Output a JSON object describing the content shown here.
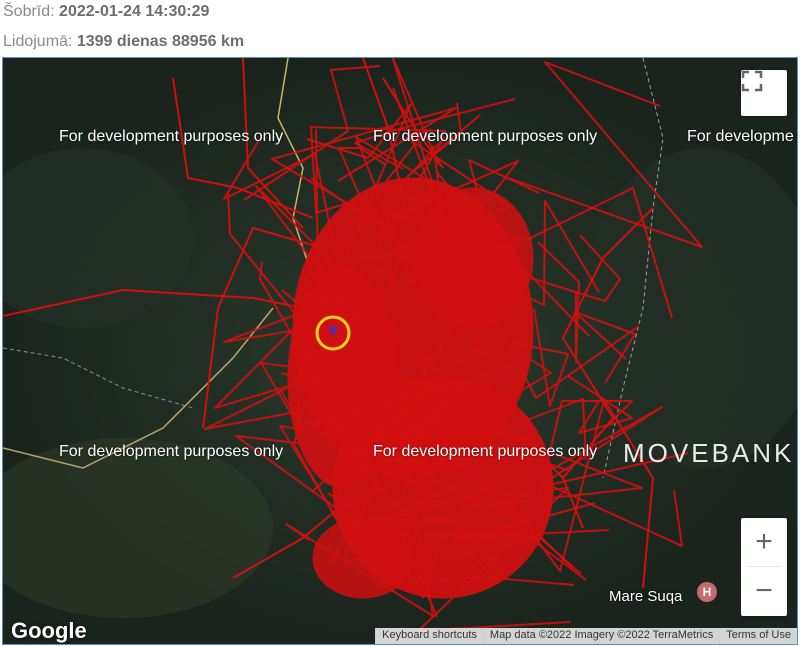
{
  "status": {
    "now_label": "Šobrīd:",
    "now_value": "2022-01-24 14:30:29",
    "flight_label": "Lidojumā:",
    "flight_value": "1399 dienas 88956 km"
  },
  "map": {
    "watermark": "For development purposes only",
    "watermark_partial": "For developme",
    "brand": "MOVEBANK",
    "place": "Mare Suqa",
    "poi_glyph": "H",
    "google": "Google",
    "attribution": {
      "shortcuts": "Keyboard shortcuts",
      "map_data": "Map data ©2022 Imagery ©2022 TerraMetrics",
      "terms": "Terms of Use"
    },
    "controls": {
      "fullscreen_icon": "fullscreen-icon",
      "zoom_in": "+",
      "zoom_out": "−"
    },
    "colors": {
      "track": "#d00f0f",
      "current_ring": "#f2d21c",
      "current_marker": "#5a2ca0",
      "terrain": "#1e2a22"
    }
  }
}
